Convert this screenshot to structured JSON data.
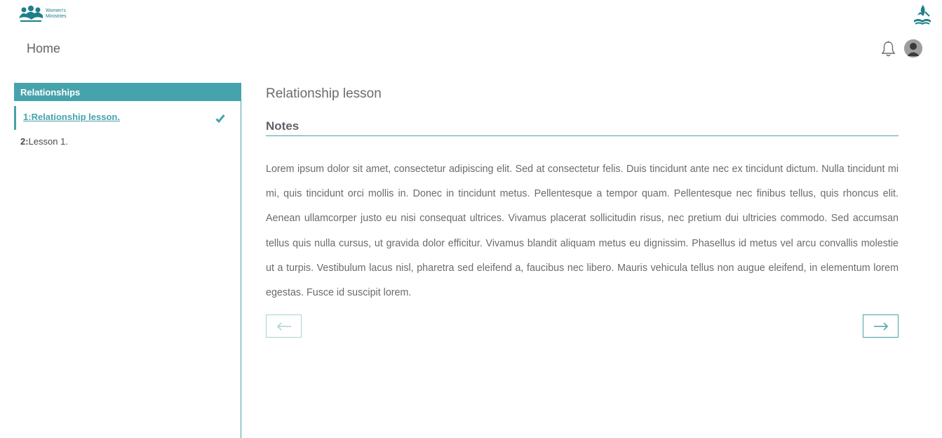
{
  "logo": {
    "line1": "Women's",
    "line2": "Ministries"
  },
  "header": {
    "title": "Home"
  },
  "icons": {
    "bell": "bell-icon",
    "avatar": "user-avatar-icon",
    "check": "check-icon",
    "prev": "arrow-left-icon",
    "next": "arrow-right-icon",
    "brand": "church-flame-logo"
  },
  "sidebar": {
    "title": "Relationships",
    "lessons": [
      {
        "num": "1:",
        "label": "Relationship lesson.",
        "active": true,
        "completed": true
      },
      {
        "num": "2:",
        "label": "Lesson 1.",
        "active": false,
        "completed": false
      }
    ]
  },
  "main": {
    "lesson_title": "Relationship lesson",
    "notes_heading": "Notes",
    "notes_text": "Lorem ipsum dolor sit amet, consectetur adipiscing elit. Sed at consectetur felis. Duis tincidunt ante nec ex tincidunt dictum. Nulla tincidunt mi mi, quis tincidunt orci mollis in. Donec in tincidunt metus. Pellentesque a tempor quam. Pellentesque nec finibus tellus, quis rhoncus elit. Aenean ullamcorper justo eu nisi consequat ultrices. Vivamus placerat sollicitudin risus, nec pretium dui ultricies commodo. Sed accumsan tellus quis nulla cursus, ut gravida dolor efficitur. Vivamus blandit aliquam metus eu dignissim. Phasellus id metus vel arcu convallis molestie ut a turpis. Vestibulum lacus nisl, pharetra sed eleifend a, faucibus nec libero. Mauris vehicula tellus non augue eleifend, in elementum lorem egestas. Fusce id suscipit lorem."
  },
  "colors": {
    "accent": "#46a3ab",
    "accent_light": "#a8d2d6",
    "text": "#6b6b6b",
    "logo": "#1e7f8a"
  }
}
